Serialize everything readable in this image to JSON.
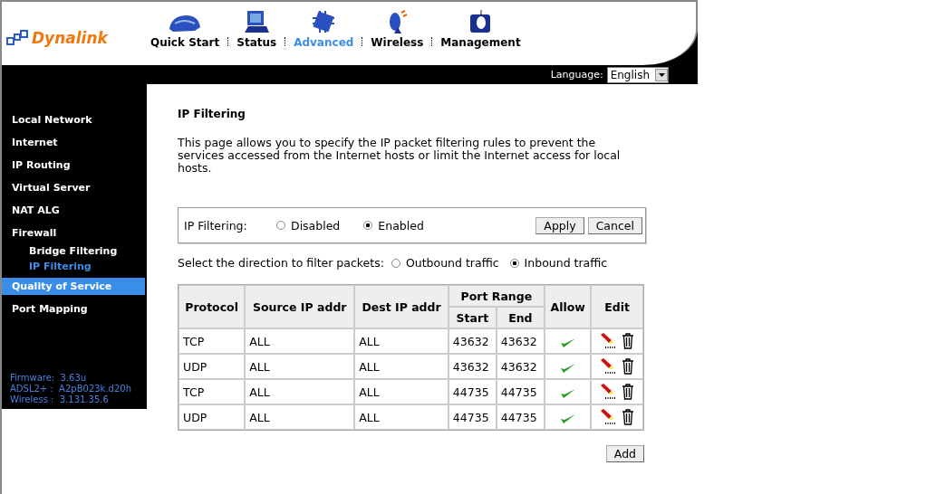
{
  "logo": {
    "text": "Dynalink"
  },
  "nav": [
    {
      "label": "Quick Start",
      "selected": false
    },
    {
      "label": "Status",
      "selected": false
    },
    {
      "label": "Advanced",
      "selected": true
    },
    {
      "label": "Wireless",
      "selected": false
    },
    {
      "label": "Management",
      "selected": false
    }
  ],
  "language": {
    "label": "Language:",
    "value": "English"
  },
  "sidebar": {
    "items": [
      {
        "label": "Local Network",
        "selected": false,
        "highlighted": false
      },
      {
        "label": "Internet",
        "selected": false,
        "highlighted": false
      },
      {
        "label": "IP Routing",
        "selected": false,
        "highlighted": false
      },
      {
        "label": "Virtual Server",
        "selected": false,
        "highlighted": false
      },
      {
        "label": "NAT ALG",
        "selected": false,
        "highlighted": false
      },
      {
        "label": "Firewall",
        "selected": false,
        "highlighted": false,
        "children": [
          {
            "label": "Bridge Filtering",
            "selected": false,
            "highlighted": false
          },
          {
            "label": "IP Filtering",
            "selected": true,
            "highlighted": false
          }
        ]
      },
      {
        "label": "Quality of Service",
        "selected": false,
        "highlighted": true
      },
      {
        "label": "Port Mapping",
        "selected": false,
        "highlighted": false
      }
    ],
    "versions": [
      "Firmware:  3.63u",
      "ADSL2+ :  A2pB023k.d20h",
      "Wireless :  3.131.35.6"
    ]
  },
  "page": {
    "title": "IP Filtering",
    "description": "This page allows you to specify the IP packet filtering rules to prevent the services accessed from the Internet hosts or limit the Internet access for local hosts.",
    "filtering": {
      "label": "IP Filtering:",
      "options": [
        {
          "label": "Disabled",
          "selected": false
        },
        {
          "label": "Enabled",
          "selected": true
        }
      ],
      "buttons": [
        "Apply",
        "Cancel"
      ]
    },
    "direction": {
      "label": "Select the direction to filter packets:",
      "options": [
        {
          "label": "Outbound traffic",
          "selected": false
        },
        {
          "label": "Inbound traffic",
          "selected": true
        }
      ]
    },
    "table": {
      "columns": [
        "Protocol",
        "Source IP addr",
        "Dest IP addr",
        "Port Range",
        "Allow",
        "Edit"
      ],
      "subcolumns": [
        "Start",
        "End"
      ],
      "rows": [
        {
          "protocol": "TCP",
          "source": "ALL",
          "dest": "ALL",
          "start": "43632",
          "end": "43632",
          "allow": true
        },
        {
          "protocol": "UDP",
          "source": "ALL",
          "dest": "ALL",
          "start": "43632",
          "end": "43632",
          "allow": true
        },
        {
          "protocol": "TCP",
          "source": "ALL",
          "dest": "ALL",
          "start": "44735",
          "end": "44735",
          "allow": true
        },
        {
          "protocol": "UDP",
          "source": "ALL",
          "dest": "ALL",
          "start": "44735",
          "end": "44735",
          "allow": true
        }
      ]
    },
    "add_button": "Add"
  }
}
